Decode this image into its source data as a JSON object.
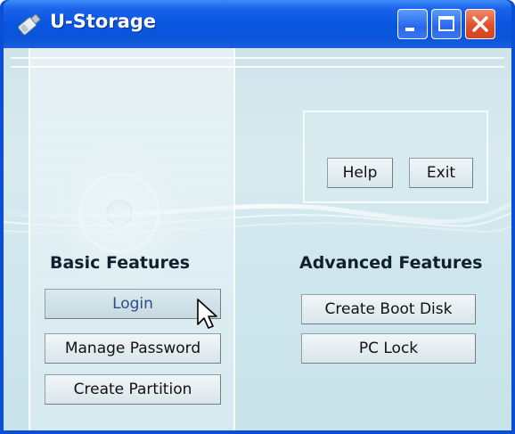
{
  "window": {
    "title": "U-Storage",
    "controls": {
      "minimize": "minimize-icon",
      "maximize": "maximize-icon",
      "close": "close-icon"
    }
  },
  "panel": {
    "help_label": "Help",
    "exit_label": "Exit"
  },
  "basic": {
    "heading": "Basic Features",
    "buttons": [
      "Login",
      "Manage Password",
      "Create Partition"
    ]
  },
  "advanced": {
    "heading": "Advanced Features",
    "buttons": [
      "Create Boot Disk",
      "PC Lock"
    ]
  },
  "colors": {
    "titlebar": "#0b55d8",
    "close_button": "#e0502a",
    "client_background": "#d7ebf0"
  }
}
